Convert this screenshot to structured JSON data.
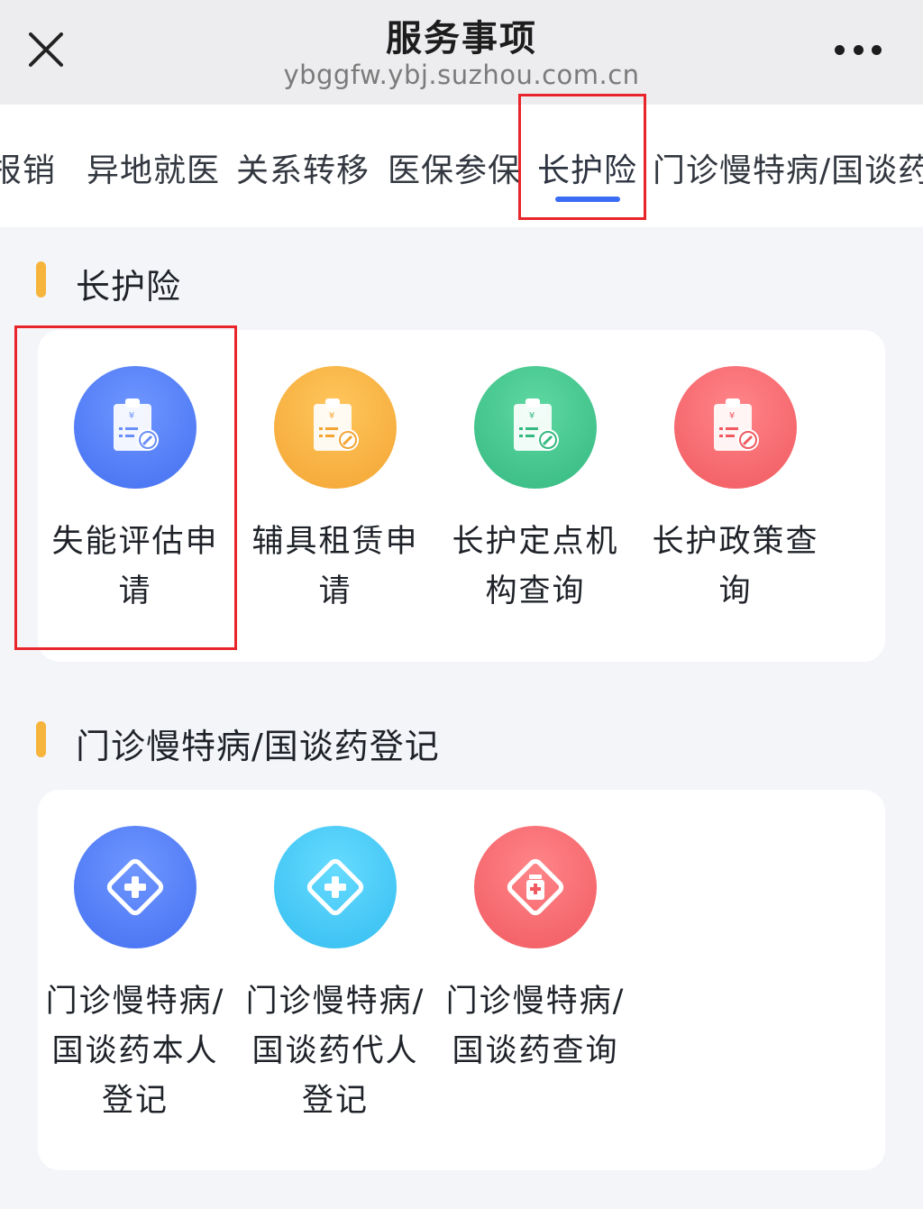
{
  "header": {
    "title": "服务事项",
    "url": "ybggfw.ybj.suzhou.com.cn"
  },
  "tabs": [
    {
      "label": "报销"
    },
    {
      "label": "异地就医"
    },
    {
      "label": "关系转移"
    },
    {
      "label": "医保参保"
    },
    {
      "label": "长护险",
      "active": true
    },
    {
      "label": "门诊慢特病/国谈药"
    }
  ],
  "sections": [
    {
      "title": "长护险",
      "items": [
        {
          "line1": "失能评估申",
          "line2": "请",
          "color": "#4f79f4",
          "icon": "clipboard-edit-icon"
        },
        {
          "line1": "辅具租赁申",
          "line2": "请",
          "color": "#f5ad3a",
          "icon": "clipboard-edit-icon"
        },
        {
          "line1": "长护定点机",
          "line2": "构查询",
          "color": "#3fc08a",
          "icon": "clipboard-edit-icon"
        },
        {
          "line1": "长护政策查",
          "line2": "询",
          "color": "#f4656a",
          "icon": "clipboard-edit-icon"
        }
      ]
    },
    {
      "title": "门诊慢特病/国谈药登记",
      "items": [
        {
          "line1": "门诊慢特病/",
          "line2": "国谈药本人",
          "line3": "登记",
          "color": "#4f79f4",
          "icon": "medical-cross-diamond-icon"
        },
        {
          "line1": "门诊慢特病/",
          "line2": "国谈药代人",
          "line3": "登记",
          "color": "#3bc3f2",
          "icon": "medical-cross-diamond-icon"
        },
        {
          "line1": "门诊慢特病/",
          "line2": "国谈药查询",
          "color": "#f4656a",
          "icon": "medicine-bottle-diamond-icon"
        }
      ]
    }
  ]
}
